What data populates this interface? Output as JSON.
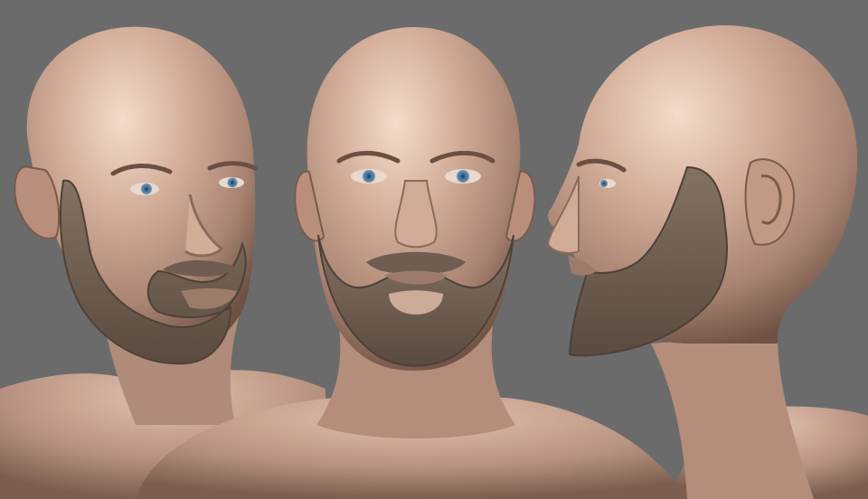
{
  "scene": {
    "views": [
      "three-quarter",
      "front",
      "profile"
    ]
  },
  "colors": {
    "background": "#6b6b6b",
    "skin": "#c9a48f",
    "skin_light": "#ead0bd",
    "skin_shadow": "#8a6a5a",
    "beard": "#7b6b5c",
    "beard_dark": "#5e5044",
    "iris": "#4f7fa5"
  }
}
